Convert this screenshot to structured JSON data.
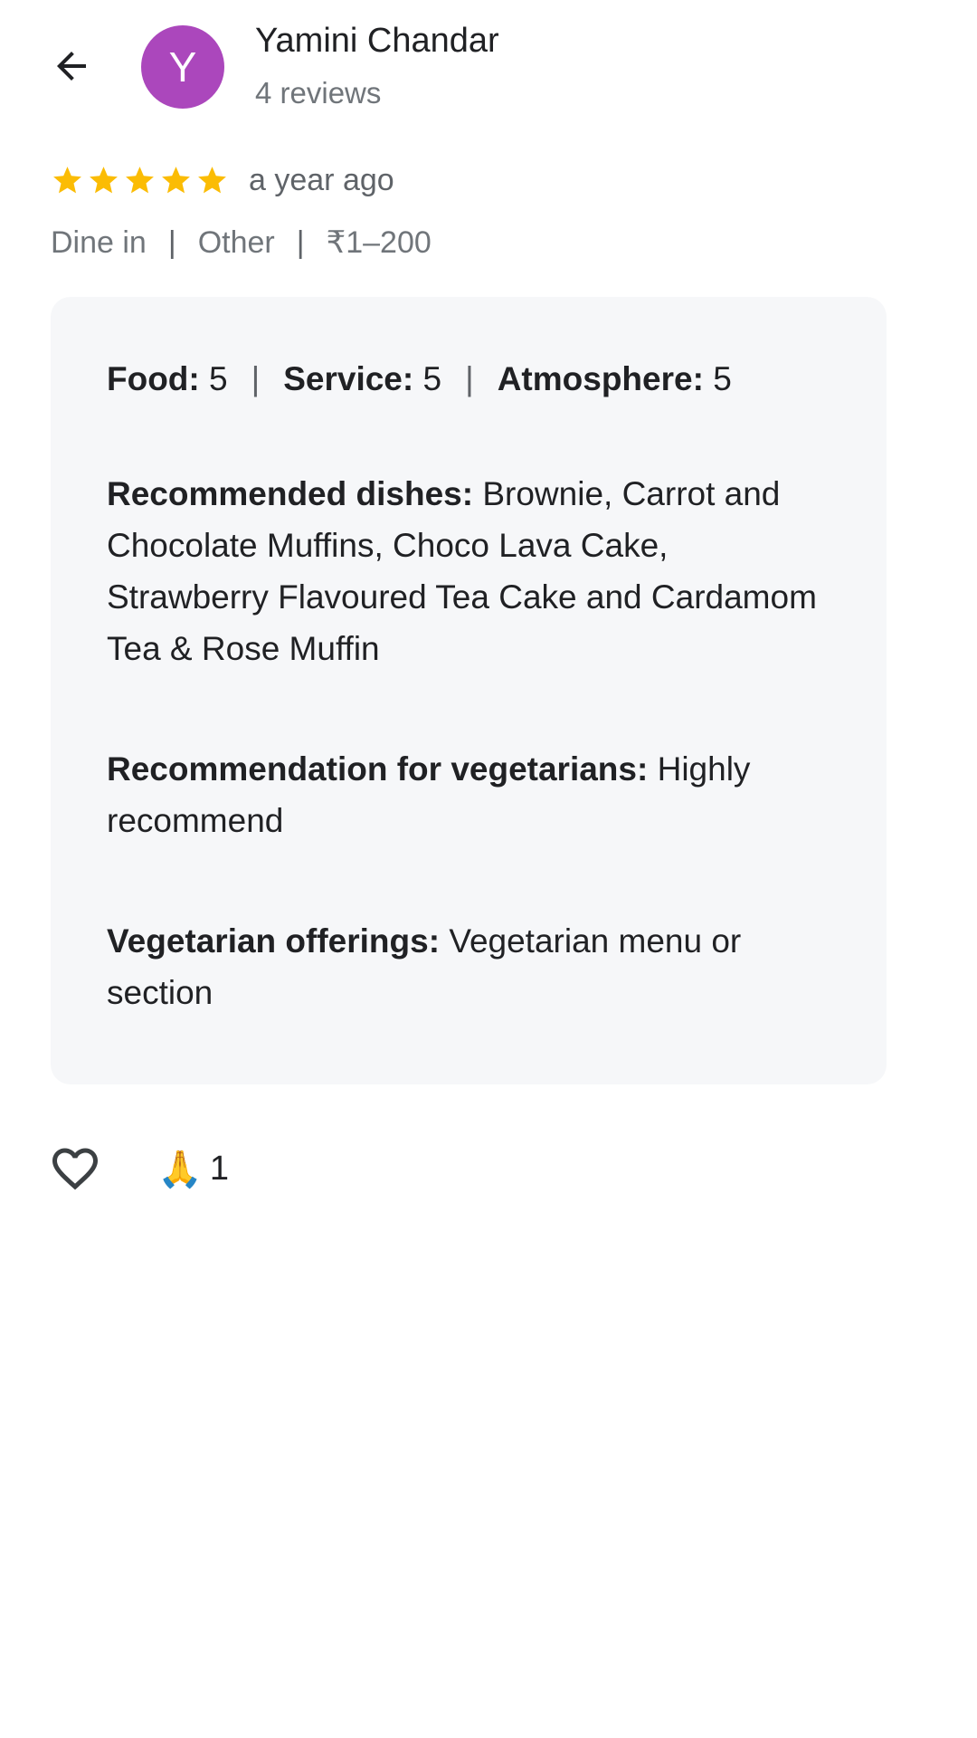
{
  "header": {
    "back_icon": "arrow-left-icon",
    "avatar_letter": "Y",
    "avatar_color": "#ab47bc",
    "reviewer_name": "Yamini Chandar",
    "review_count": "4 reviews"
  },
  "review": {
    "stars": 5,
    "star_color": "#fbbc04",
    "time_ago": "a year ago",
    "tags": [
      "Dine in",
      "Other",
      "₹1–200"
    ],
    "ratings": {
      "food_label": "Food:",
      "food_value": "5",
      "service_label": "Service:",
      "service_value": "5",
      "atmosphere_label": "Atmosphere:",
      "atmosphere_value": "5"
    },
    "recommended_dishes_label": "Recommended dishes:",
    "recommended_dishes_value": "Brownie, Carrot and Chocolate Muffins, Choco Lava Cake, Strawberry Flavoured Tea Cake and Cardamom Tea & Rose Muffin",
    "veg_recommendation_label": "Recommendation for vegetarians:",
    "veg_recommendation_value": "Highly recommend",
    "veg_offerings_label": "Vegetarian offerings:",
    "veg_offerings_value": "Vegetarian menu or section"
  },
  "actions": {
    "like_icon": "heart-outline-icon",
    "reaction_emoji": "🙏",
    "reaction_count": "1"
  }
}
